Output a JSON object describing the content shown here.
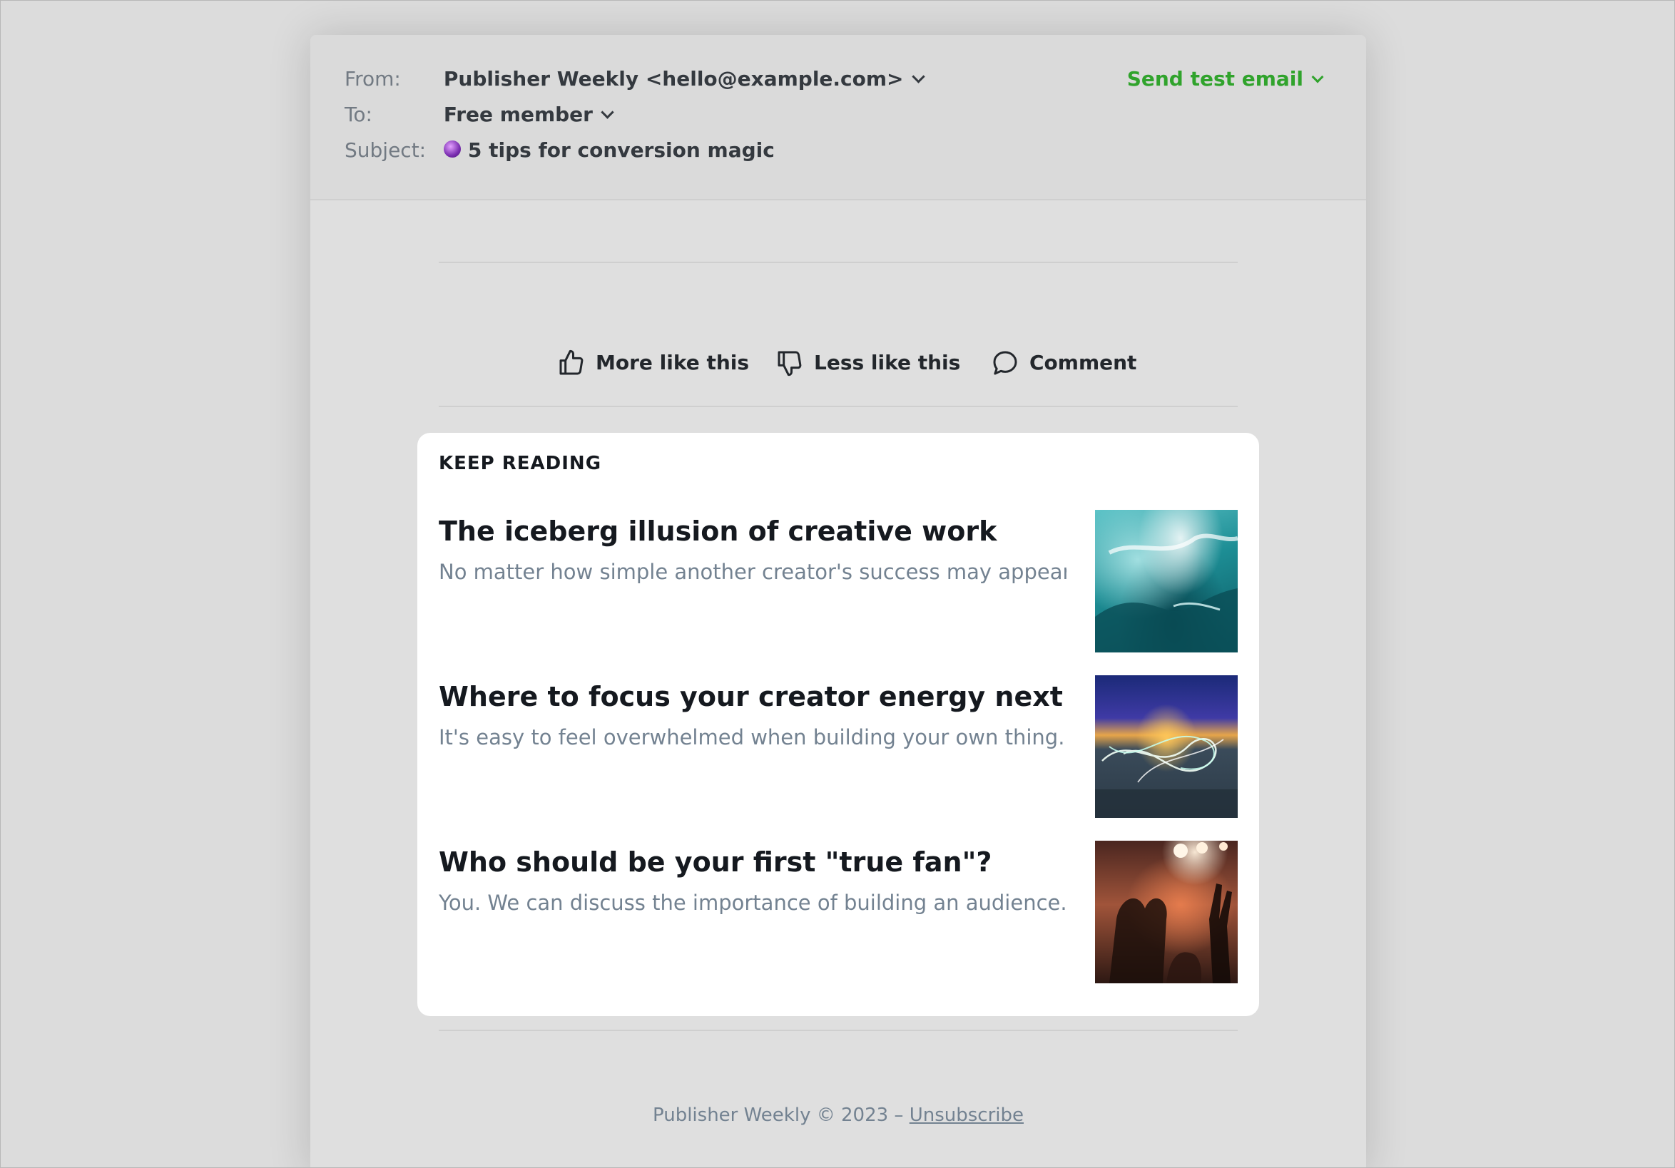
{
  "header": {
    "from_label": "From:",
    "from_value": "Publisher Weekly <hello@example.com>",
    "to_label": "To:",
    "to_value": "Free member",
    "subject_label": "Subject:",
    "subject_icon": "crystal-ball-icon",
    "subject_value": "5 tips for conversion magic",
    "send_test_label": "Send test email"
  },
  "feedback": {
    "more": "More like this",
    "less": "Less like this",
    "comment": "Comment"
  },
  "keep_reading": {
    "title": "KEEP READING",
    "posts": [
      {
        "title": "The iceberg illusion of creative work",
        "excerpt": "No matter how simple another creator's success may appear f..."
      },
      {
        "title": "Where to focus your creator energy next",
        "excerpt": "It's easy to feel overwhelmed when building your own thing...."
      },
      {
        "title": "Who should be your first \"true fan\"?",
        "excerpt": "You. We can discuss the importance of building an audience..."
      }
    ]
  },
  "footer": {
    "text": "Publisher Weekly © 2023 – ",
    "unsubscribe": "Unsubscribe"
  },
  "colors": {
    "accent_green": "#30a32c",
    "muted_text": "#738291",
    "heading_text": "#15191f"
  }
}
